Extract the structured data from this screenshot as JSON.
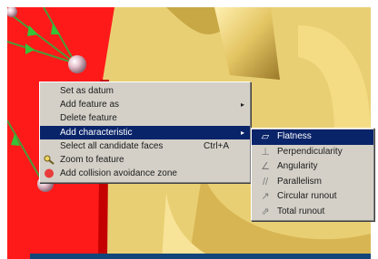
{
  "context_menu": {
    "items": [
      {
        "label": "Set as datum",
        "shortcut": "",
        "submenu": false
      },
      {
        "label": "Add feature as",
        "shortcut": "",
        "submenu": true
      },
      {
        "label": "Delete feature",
        "shortcut": "",
        "submenu": false
      },
      {
        "label": "Add characteristic",
        "shortcut": "",
        "submenu": true,
        "highlighted": true
      },
      {
        "label": "Select all candidate faces",
        "shortcut": "Ctrl+A",
        "submenu": false
      },
      {
        "label": "Zoom to feature",
        "shortcut": "",
        "submenu": false,
        "icon": "zoom-icon"
      },
      {
        "label": "Add collision avoidance zone",
        "shortcut": "",
        "submenu": false,
        "icon": "collision-zone-icon"
      }
    ],
    "submenu_arrow": "▸"
  },
  "characteristic_submenu": {
    "items": [
      {
        "label": "Flatness",
        "icon": "flatness-icon",
        "symbol": "▱",
        "highlighted": true
      },
      {
        "label": "Perpendicularity",
        "icon": "perpendicularity-icon",
        "symbol": "⊥"
      },
      {
        "label": "Angularity",
        "icon": "angularity-icon",
        "symbol": "∠"
      },
      {
        "label": "Parallelism",
        "icon": "parallelism-icon",
        "symbol": "//"
      },
      {
        "label": "Circular runout",
        "icon": "circular-runout-icon",
        "symbol": "↗"
      },
      {
        "label": "Total runout",
        "icon": "total-runout-icon",
        "symbol": "⇗"
      }
    ]
  },
  "colors": {
    "menu_background": "#d4d0c8",
    "highlight": "#0a246a",
    "part_red": "#ff1a1a",
    "part_gold": "#e9cf73",
    "bottom_bar": "#12467a"
  }
}
